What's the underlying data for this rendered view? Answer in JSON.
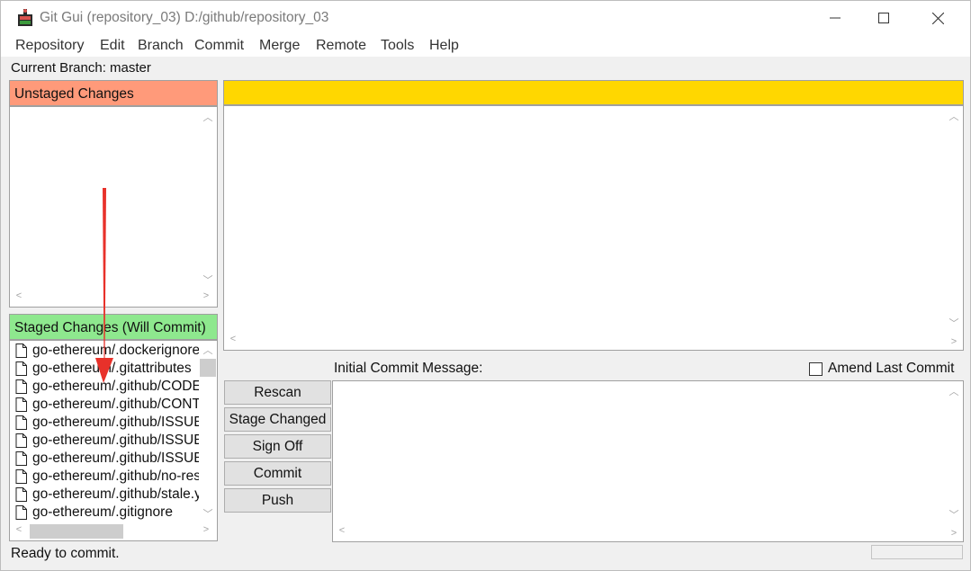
{
  "window": {
    "title": "Git Gui (repository_03) D:/github/repository_03"
  },
  "menubar": [
    {
      "label": "Repository"
    },
    {
      "label": "Edit"
    },
    {
      "label": "Branch"
    },
    {
      "label": "Commit"
    },
    {
      "label": "Merge"
    },
    {
      "label": "Remote"
    },
    {
      "label": "Tools"
    },
    {
      "label": "Help"
    }
  ],
  "branch": {
    "label": "Current Branch: master"
  },
  "unstaged": {
    "header": "Unstaged Changes",
    "files": []
  },
  "staged": {
    "header": "Staged Changes (Will Commit)",
    "files": [
      "go-ethereum/.dockerignore",
      "go-ethereum/.gitattributes",
      "go-ethereum/.github/CODEOWNERS",
      "go-ethereum/.github/CONTRIBUTING.md",
      "go-ethereum/.github/ISSUE_TEMPLATE",
      "go-ethereum/.github/ISSUE_TEMPLATE",
      "go-ethereum/.github/ISSUE_TEMPLATE",
      "go-ethereum/.github/no-response.yml",
      "go-ethereum/.github/stale.yml",
      "go-ethereum/.gitignore"
    ]
  },
  "commit": {
    "message_label": "Initial Commit Message:",
    "amend_label": "Amend Last Commit",
    "amend_checked": false
  },
  "actions": {
    "rescan": "Rescan",
    "stage_changed": "Stage Changed",
    "sign_off": "Sign Off",
    "commit": "Commit",
    "push": "Push"
  },
  "status": {
    "text": "Ready to commit."
  },
  "colors": {
    "unstaged_header": "#ff9a7a",
    "staged_header": "#8ee88e",
    "diff_header": "#ffd700",
    "annotation_arrow": "#e8312a"
  },
  "icons": {
    "app": "git-gui-icon",
    "file": "file-icon",
    "minimize": "minimize-icon",
    "maximize": "maximize-icon",
    "close": "close-icon"
  }
}
